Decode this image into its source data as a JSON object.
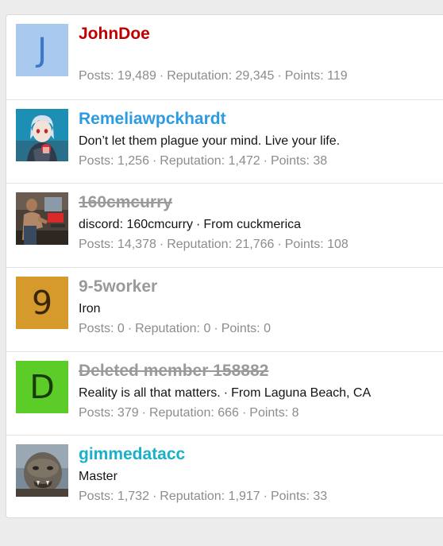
{
  "members": [
    {
      "username": "JohnDoe",
      "username_color": "#c00000",
      "struck": false,
      "avatar": {
        "type": "letter",
        "letter": "J",
        "bg": "#a8c8ee",
        "fg": "#3a78c8"
      },
      "title": "",
      "location": "",
      "posts_label": "Posts:",
      "posts": "19,489",
      "reputation_label": "Reputation:",
      "reputation": "29,345",
      "points_label": "Points:",
      "points": "119"
    },
    {
      "username": "Remeliawpckhardt",
      "username_color": "#2d9be2",
      "struck": false,
      "avatar": {
        "type": "image",
        "icon": "anime-girl-avatar"
      },
      "title": "Don’t let them plague your mind. Live your life.",
      "location": "",
      "posts_label": "Posts:",
      "posts": "1,256",
      "reputation_label": "Reputation:",
      "reputation": "1,472",
      "points_label": "Points:",
      "points": "38"
    },
    {
      "username": "160cmcurry",
      "username_color": "#9a9a9a",
      "struck": true,
      "avatar": {
        "type": "image",
        "icon": "gym-photo-avatar"
      },
      "title": "discord: 160cmcurry",
      "location": "From cuckmerica",
      "posts_label": "Posts:",
      "posts": "14,378",
      "reputation_label": "Reputation:",
      "reputation": "21,766",
      "points_label": "Points:",
      "points": "108"
    },
    {
      "username": "9-5worker",
      "username_color": "#9a9a9a",
      "struck": false,
      "avatar": {
        "type": "letter",
        "letter": "9",
        "bg": "#d69a2c",
        "fg": "#3a2608"
      },
      "title": "Iron",
      "location": "",
      "posts_label": "Posts:",
      "posts": "0",
      "reputation_label": "Reputation:",
      "reputation": "0",
      "points_label": "Points:",
      "points": "0"
    },
    {
      "username": "Deleted member 158882",
      "username_color": "#9a9a9a",
      "struck": true,
      "avatar": {
        "type": "letter",
        "letter": "D",
        "bg": "#5ccc28",
        "fg": "#1a3a08"
      },
      "title": "Reality is all that matters.",
      "location": "From Laguna Beach, CA",
      "posts_label": "Posts:",
      "posts": "379",
      "reputation_label": "Reputation:",
      "reputation": "666",
      "points_label": "Points:",
      "points": "8"
    },
    {
      "username": "gimmedatacc",
      "username_color": "#19b0c8",
      "struck": false,
      "avatar": {
        "type": "image",
        "icon": "orc-face-avatar"
      },
      "title": "Master",
      "location": "",
      "posts_label": "Posts:",
      "posts": "1,732",
      "reputation_label": "Reputation:",
      "reputation": "1,917",
      "points_label": "Points:",
      "points": "33"
    }
  ],
  "separator": "·"
}
